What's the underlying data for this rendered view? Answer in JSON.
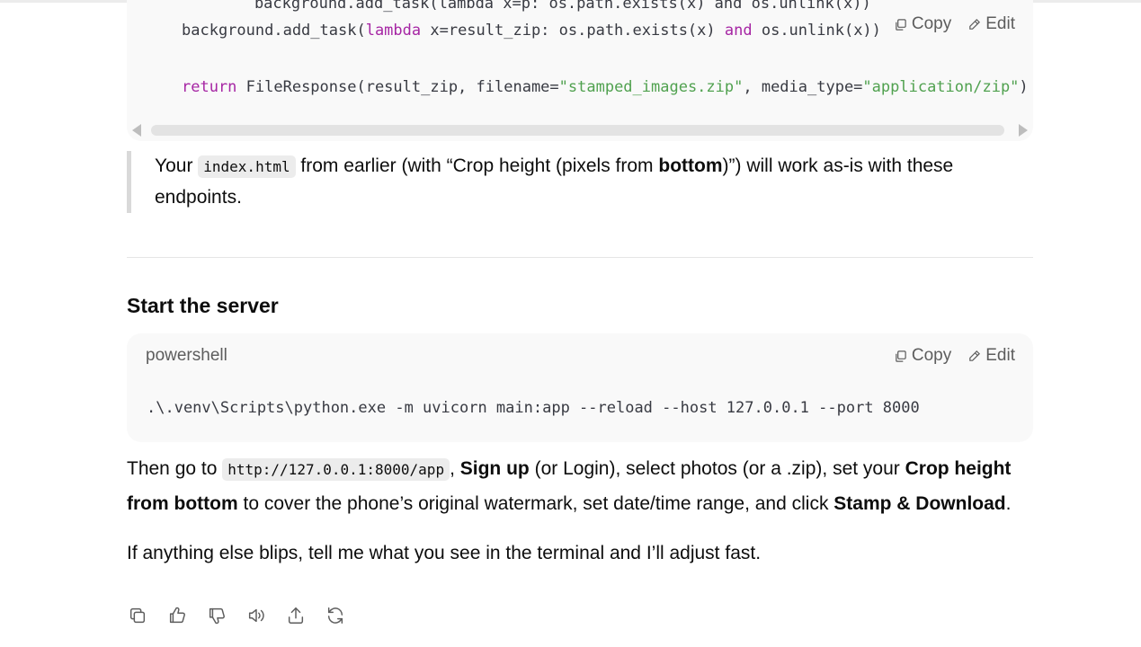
{
  "code_block_1": {
    "lines": {
      "partial_top": "    background.add_task(lambda x=p: os.path.exists(x) and os.unlink(x))",
      "line_a_pre": "background.add_task(",
      "line_a_kw1": "lambda",
      "line_a_mid": " x=result_zip: os.path.exists(x) ",
      "line_a_kw2": "and",
      "line_a_post": " os.unlink(x))",
      "line_b_kw": "return",
      "line_b_pre": " FileResponse(result_zip, filename=",
      "line_b_str1": "\"stamped_images.zip\"",
      "line_b_mid": ", media_type=",
      "line_b_str2": "\"application/zip\"",
      "line_b_post": ")"
    },
    "copy_label": "Copy",
    "edit_label": "Edit"
  },
  "note": {
    "prefix": "Your ",
    "code": "index.html",
    "middle": " from earlier (with “Crop height (pixels from ",
    "bold": "bottom",
    "suffix": ")”) will work as-is with these endpoints."
  },
  "section_heading": "Start the server",
  "code_block_2": {
    "language": "powershell",
    "command": ".\\.venv\\Scripts\\python.exe -m uvicorn main:app --reload --host 127.0.0.1 --port 8000",
    "copy_label": "Copy",
    "edit_label": "Edit"
  },
  "paragraph_1": {
    "t1": "Then go to ",
    "code": "http://127.0.0.1:8000/app",
    "t2": ", ",
    "b1": "Sign up",
    "t3": " (or Login), select photos (or a .zip), set your ",
    "b2": "Crop height from bottom",
    "t4": " to cover the phone’s original watermark, set date/time range, and click ",
    "b3": "Stamp & Download",
    "t5": "."
  },
  "paragraph_2": "If anything else blips, tell me what you see in the terminal and I’ll adjust fast.",
  "toolbar": {
    "icons": [
      "copy-icon",
      "thumbs-up-icon",
      "thumbs-down-icon",
      "read-aloud-icon",
      "share-icon",
      "regenerate-icon"
    ]
  },
  "colors": {
    "keyword": "#a626a4",
    "string": "#50a14f",
    "code_bg": "#f9f9f9",
    "muted_text": "#5d5d5d"
  }
}
